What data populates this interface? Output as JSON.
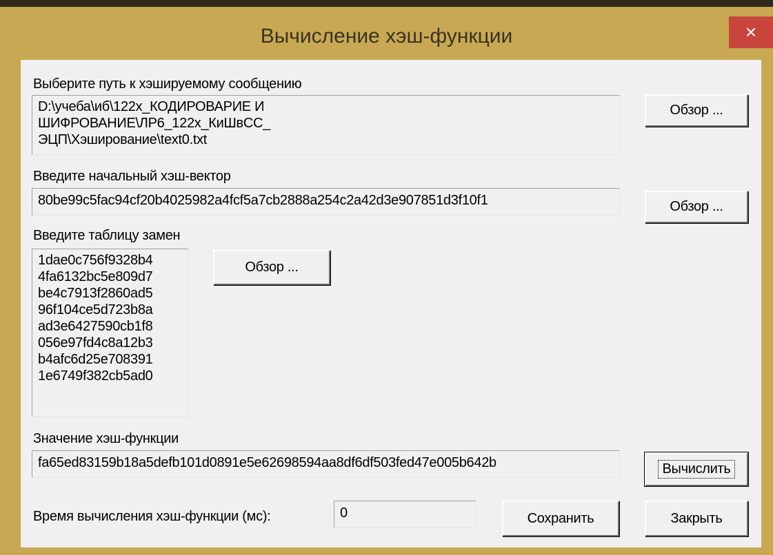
{
  "window": {
    "title": "Вычисление хэш-функции",
    "close_symbol": "×"
  },
  "message": {
    "label": "Выберите путь к хэшируемому сообщению",
    "path": "D:\\учеба\\иб\\122х_КОДИРОВАРИЕ И\nШИФРОВАНИЕ\\ЛР6_122х_КиШвСС_\nЭЦП\\Хэширование\\text0.txt",
    "browse_label": "Обзор ..."
  },
  "init_vector": {
    "label": "Введите начальный хэш-вектор",
    "value": "80be99c5fac94cf20b4025982a4fcf5a7cb2888a254c2a42d3e907851d3f10f1",
    "browse_label": "Обзор ..."
  },
  "substitution": {
    "label": "Введите таблицу замен",
    "rows": "1dae0c756f9328b4\n4fa6132bc5e809d7\nbe4c7913f2860ad5\n96f104ce5d723b8a\nad3e6427590cb1f8\n056e97fd4c8a12b3\nb4afc6d25e708391\n1e6749f382cb5ad0",
    "browse_label": "Обзор ..."
  },
  "hash": {
    "label": "Значение хэш-функции",
    "value": "fa65ed83159b18a5defb101d0891e5e62698594aa8df6df503fed47e005b642b",
    "compute_label": "Вычислить"
  },
  "timing": {
    "label": "Время вычисления хэш-функции (мс):",
    "value": "0"
  },
  "actions": {
    "save_label": "Сохранить",
    "close_label": "Закрыть"
  }
}
